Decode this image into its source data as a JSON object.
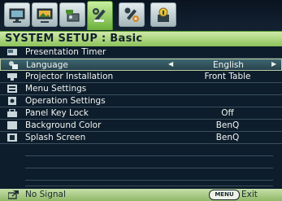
{
  "tabs": [
    {
      "name": "display-tab",
      "icon": "monitor-icon"
    },
    {
      "name": "picture-tab",
      "icon": "picture-icon"
    },
    {
      "name": "source-tab",
      "icon": "source-icon"
    },
    {
      "name": "system-setup-basic-tab",
      "icon": "wrench-icon",
      "active": true
    },
    {
      "name": "system-setup-advanced-tab",
      "icon": "advanced-settings-icon"
    },
    {
      "name": "information-tab",
      "icon": "info-icon"
    }
  ],
  "header": {
    "title": "SYSTEM SETUP : Basic"
  },
  "rows": [
    {
      "label": "Presentation Timer",
      "value": "",
      "icon": "timer-icon"
    },
    {
      "label": "Language",
      "value": "English",
      "icon": "language-icon",
      "selected": true
    },
    {
      "label": "Projector Installation",
      "value": "Front Table",
      "icon": "projector-icon"
    },
    {
      "label": "Menu Settings",
      "value": "",
      "icon": "menu-icon"
    },
    {
      "label": "Operation Settings",
      "value": "",
      "icon": "operation-icon"
    },
    {
      "label": "Panel Key Lock",
      "value": "Off",
      "icon": "lock-icon"
    },
    {
      "label": "Background Color",
      "value": "BenQ",
      "icon": "background-color-icon"
    },
    {
      "label": "Splash Screen",
      "value": "BenQ",
      "icon": "splash-screen-icon"
    }
  ],
  "footer": {
    "status": "No Signal",
    "menu_key": "MENU",
    "exit_label": "Exit"
  },
  "colors": {
    "background": "#0d1d2c",
    "header": "#a8d27a",
    "selected_row": "#34565f",
    "text": "#f2f4f0"
  }
}
